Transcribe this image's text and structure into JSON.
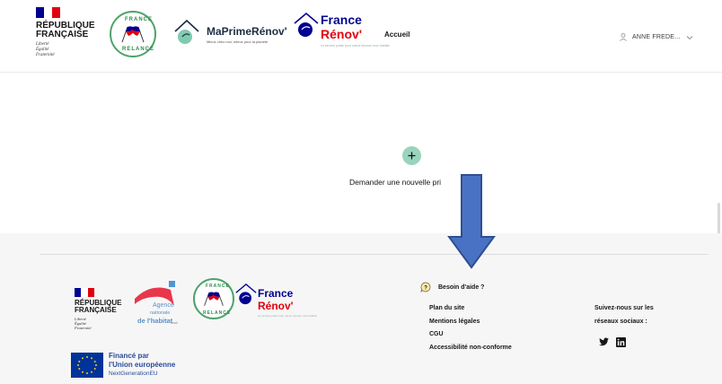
{
  "header": {
    "republique": {
      "line1": "RÉPUBLIQUE",
      "line2": "FRANÇAISE",
      "motto": [
        "Liberté",
        "Égalité",
        "Fraternité"
      ]
    },
    "relance_seal": {
      "top": "FRANCE",
      "bottom": "RELANCE"
    },
    "maprimerenov": {
      "title": "MaPrimeRénov'",
      "subtitle": "Mieux chez moi, mieux pour la planète"
    },
    "france_renov": {
      "line1": "France",
      "line2": "Rénov'",
      "tagline": "Le service public pour mieux rénover mon habitat"
    },
    "nav": {
      "home": "Accueil"
    },
    "user": {
      "name": "ANNE FREDE..."
    }
  },
  "main": {
    "new_request_label": "Demander une nouvelle pri"
  },
  "footer": {
    "republique": {
      "line1": "RÉPUBLIQUE",
      "line2": "FRANÇAISE",
      "motto": [
        "Liberté",
        "Égalité",
        "Fraternité"
      ]
    },
    "anah": {
      "line1": "Agence",
      "line2": "nationale",
      "line3": "de l'habitat",
      "small": "anah"
    },
    "relance_seal": {
      "top": "FRANCE",
      "bottom": "RELANCE"
    },
    "france_renov": {
      "line1": "France",
      "line2": "Rénov'",
      "tagline": "Le service public pour mieux rénover mon habitat"
    },
    "eu": {
      "line1": "Financé par",
      "line2": "l'Union européenne",
      "line3": "NextGenerationEU"
    },
    "help": {
      "label": "Besoin d'aide ?"
    },
    "links": [
      {
        "label": "Plan du site"
      },
      {
        "label": "Mentions légales"
      },
      {
        "label": "CGU"
      },
      {
        "label": "Accessibilité non-conforme"
      }
    ],
    "social": {
      "line1": "Suivez-nous sur les",
      "line2": "réseaux sociaux :",
      "icons": [
        "twitter-icon",
        "linkedin-icon"
      ]
    }
  },
  "colors": {
    "marianne_blue": "#000091",
    "marianne_red": "#e1000f",
    "add_button": "#9ad4bd",
    "arrow_fill": "#4a72c4",
    "arrow_stroke": "#2e4f8f",
    "footer_bg": "#f6f6f6"
  }
}
